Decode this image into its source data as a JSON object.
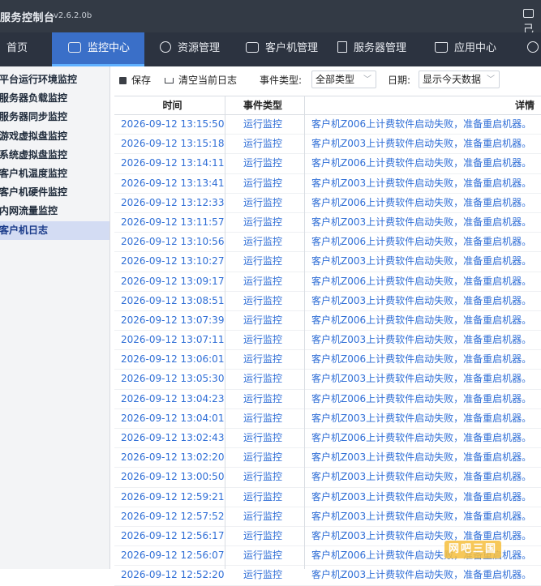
{
  "titlebar": {
    "title": "服务控制台",
    "version": "v2.6.2.0b",
    "right_label": "己"
  },
  "nav": {
    "items": [
      {
        "label": "首页",
        "icon": "home-icon"
      },
      {
        "label": "监控中心",
        "icon": "chart-icon"
      },
      {
        "label": "资源管理",
        "icon": "gamepad-icon"
      },
      {
        "label": "客户机管理",
        "icon": "monitor-icon"
      },
      {
        "label": "服务器管理",
        "icon": "server-icon"
      },
      {
        "label": "应用中心",
        "icon": "bag-icon"
      }
    ],
    "active_index": 1,
    "shield_icon": "shield-icon"
  },
  "sidebar": {
    "items": [
      {
        "label": "平台运行环境监控"
      },
      {
        "label": "服务器负载监控"
      },
      {
        "label": "服务器同步监控"
      },
      {
        "label": "游戏虚拟盘监控"
      },
      {
        "label": "系统虚拟盘监控"
      },
      {
        "label": "客户机温度监控"
      },
      {
        "label": "客户机硬件监控"
      },
      {
        "label": "内网流量监控"
      },
      {
        "label": "客户机日志"
      }
    ],
    "active_index": 8
  },
  "toolbar": {
    "save_label": "保存",
    "clear_label": "清空当前日志",
    "event_type_label": "事件类型:",
    "event_type_value": "全部类型",
    "date_label": "日期:",
    "date_value": "显示今天数据"
  },
  "table": {
    "headers": {
      "time": "时间",
      "type": "事件类型",
      "detail": "详情"
    },
    "rows": [
      {
        "time": "2026-09-12 13:15:50",
        "type": "运行监控",
        "detail": "客户机Z006上计费软件启动失败，准备重启机器。"
      },
      {
        "time": "2026-09-12 13:15:18",
        "type": "运行监控",
        "detail": "客户机Z003上计费软件启动失败，准备重启机器。"
      },
      {
        "time": "2026-09-12 13:14:11",
        "type": "运行监控",
        "detail": "客户机Z006上计费软件启动失败，准备重启机器。"
      },
      {
        "time": "2026-09-12 13:13:41",
        "type": "运行监控",
        "detail": "客户机Z003上计费软件启动失败，准备重启机器。"
      },
      {
        "time": "2026-09-12 13:12:33",
        "type": "运行监控",
        "detail": "客户机Z006上计费软件启动失败，准备重启机器。"
      },
      {
        "time": "2026-09-12 13:11:57",
        "type": "运行监控",
        "detail": "客户机Z003上计费软件启动失败，准备重启机器。"
      },
      {
        "time": "2026-09-12 13:10:56",
        "type": "运行监控",
        "detail": "客户机Z006上计费软件启动失败，准备重启机器。"
      },
      {
        "time": "2026-09-12 13:10:27",
        "type": "运行监控",
        "detail": "客户机Z003上计费软件启动失败，准备重启机器。"
      },
      {
        "time": "2026-09-12 13:09:17",
        "type": "运行监控",
        "detail": "客户机Z006上计费软件启动失败，准备重启机器。"
      },
      {
        "time": "2026-09-12 13:08:51",
        "type": "运行监控",
        "detail": "客户机Z003上计费软件启动失败，准备重启机器。"
      },
      {
        "time": "2026-09-12 13:07:39",
        "type": "运行监控",
        "detail": "客户机Z006上计费软件启动失败，准备重启机器。"
      },
      {
        "time": "2026-09-12 13:07:11",
        "type": "运行监控",
        "detail": "客户机Z003上计费软件启动失败，准备重启机器。"
      },
      {
        "time": "2026-09-12 13:06:01",
        "type": "运行监控",
        "detail": "客户机Z006上计费软件启动失败，准备重启机器。"
      },
      {
        "time": "2026-09-12 13:05:30",
        "type": "运行监控",
        "detail": "客户机Z003上计费软件启动失败，准备重启机器。"
      },
      {
        "time": "2026-09-12 13:04:23",
        "type": "运行监控",
        "detail": "客户机Z006上计费软件启动失败，准备重启机器。"
      },
      {
        "time": "2026-09-12 13:04:01",
        "type": "运行监控",
        "detail": "客户机Z003上计费软件启动失败，准备重启机器。"
      },
      {
        "time": "2026-09-12 13:02:43",
        "type": "运行监控",
        "detail": "客户机Z006上计费软件启动失败，准备重启机器。"
      },
      {
        "time": "2026-09-12 13:02:20",
        "type": "运行监控",
        "detail": "客户机Z003上计费软件启动失败，准备重启机器。"
      },
      {
        "time": "2026-09-12 13:00:50",
        "type": "运行监控",
        "detail": "客户机Z003上计费软件启动失败，准备重启机器。"
      },
      {
        "time": "2026-09-12 12:59:21",
        "type": "运行监控",
        "detail": "客户机Z003上计费软件启动失败，准备重启机器。"
      },
      {
        "time": "2026-09-12 12:57:52",
        "type": "运行监控",
        "detail": "客户机Z003上计费软件启动失败，准备重启机器。"
      },
      {
        "time": "2026-09-12 12:56:17",
        "type": "运行监控",
        "detail": "客户机Z003上计费软件启动失败，准备重启机器。"
      },
      {
        "time": "2026-09-12 12:56:07",
        "type": "运行监控",
        "detail": "客户机Z006上计费软件启动失败，准备重启机器。"
      },
      {
        "time": "2026-09-12 12:52:20",
        "type": "运行监控",
        "detail": "客户机Z003上计费软件启动失败，准备重启机器。"
      }
    ]
  },
  "watermark": {
    "text": "网吧三国"
  },
  "colors": {
    "titlebar": "#333a45",
    "navbar": "#2c3340",
    "nav_active": "#3a6fc8",
    "sidebar_active": "#d3dcf3",
    "link_text": "#2f6ed6"
  }
}
